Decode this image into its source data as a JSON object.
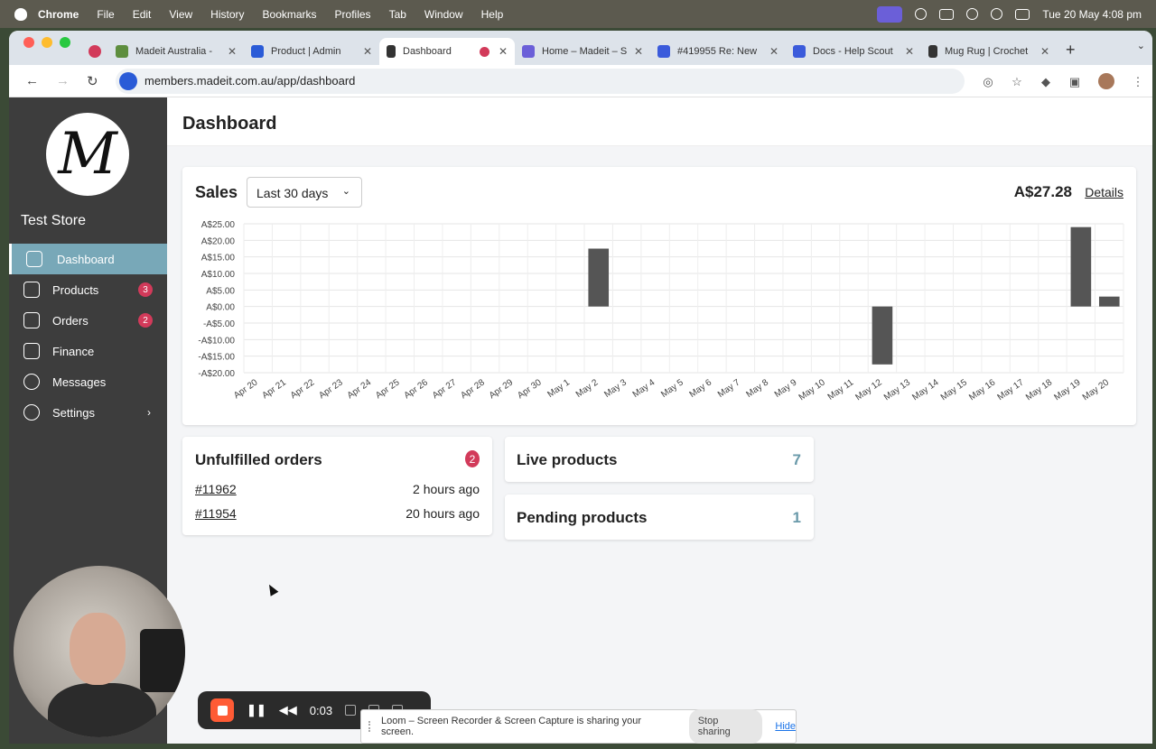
{
  "menubar": {
    "app": "Chrome",
    "items": [
      "File",
      "Edit",
      "View",
      "History",
      "Bookmarks",
      "Profiles",
      "Tab",
      "Window",
      "Help"
    ],
    "clock": "Tue 20 May  4:08 pm"
  },
  "tabs": [
    {
      "title": "Madeit Australia -",
      "icon": "shopify-icon",
      "color": "#5e8e3e"
    },
    {
      "title": "Product | Admin",
      "icon": "admin-icon",
      "color": "#2a5bd7"
    },
    {
      "title": "Dashboard",
      "icon": "madeit-icon",
      "color": "#333333",
      "active": true
    },
    {
      "title": "Home – Madeit – S",
      "icon": "s-icon",
      "color": "#6b5fd8"
    },
    {
      "title": "#419955 Re: New",
      "icon": "helpscout-icon",
      "color": "#3b5bdb"
    },
    {
      "title": "Docs - Help Scout",
      "icon": "helpscout-icon",
      "color": "#3b5bdb"
    },
    {
      "title": "Mug Rug | Crochet",
      "icon": "madeit-icon",
      "color": "#333333"
    }
  ],
  "address": {
    "url": "members.madeit.com.au/app/dashboard"
  },
  "sidebar": {
    "logo": "M",
    "store_name": "Test Store",
    "items": [
      {
        "label": "Dashboard",
        "icon": "home-icon",
        "active": true
      },
      {
        "label": "Products",
        "icon": "layers-icon",
        "badge": "3"
      },
      {
        "label": "Orders",
        "icon": "book-icon",
        "badge": "2"
      },
      {
        "label": "Finance",
        "icon": "money-icon"
      },
      {
        "label": "Messages",
        "icon": "chat-icon"
      },
      {
        "label": "Settings",
        "icon": "gear-icon",
        "chevron": "›"
      }
    ]
  },
  "page": {
    "title": "Dashboard"
  },
  "sales": {
    "heading": "Sales",
    "range": "Last 30 days",
    "total": "A$27.28",
    "details_label": "Details"
  },
  "chart_data": {
    "type": "bar",
    "title": "",
    "xlabel": "",
    "ylabel": "",
    "ylim": [
      -20,
      25
    ],
    "yticks": [
      "A$25.00",
      "A$20.00",
      "A$15.00",
      "A$10.00",
      "A$5.00",
      "A$0.00",
      "-A$5.00",
      "-A$10.00",
      "-A$15.00",
      "-A$20.00"
    ],
    "categories": [
      "Apr 20",
      "Apr 21",
      "Apr 22",
      "Apr 23",
      "Apr 24",
      "Apr 25",
      "Apr 26",
      "Apr 27",
      "Apr 28",
      "Apr 29",
      "Apr 30",
      "May 1",
      "May 2",
      "May 3",
      "May 4",
      "May 5",
      "May 6",
      "May 7",
      "May 8",
      "May 9",
      "May 10",
      "May 11",
      "May 12",
      "May 13",
      "May 14",
      "May 15",
      "May 16",
      "May 17",
      "May 18",
      "May 19",
      "May 20"
    ],
    "values": [
      0,
      0,
      0,
      0,
      0,
      0,
      0,
      0,
      0,
      0,
      0,
      0,
      17.5,
      0,
      0,
      0,
      0,
      0,
      0,
      0,
      0,
      0,
      -17.5,
      0,
      0,
      0,
      0,
      0,
      0,
      24,
      3
    ],
    "grid": true,
    "bar_color": "#555555"
  },
  "unfulfilled": {
    "heading": "Unfulfilled orders",
    "count": "2",
    "orders": [
      {
        "id": "#11962",
        "time": "2 hours ago"
      },
      {
        "id": "#11954",
        "time": "20 hours ago"
      }
    ]
  },
  "live_products": {
    "label": "Live products",
    "value": "7"
  },
  "pending_products": {
    "label": "Pending products",
    "value": "1"
  },
  "loom": {
    "timer": "0:03",
    "share_text": "Loom – Screen Recorder & Screen Capture is sharing your screen.",
    "stop_label": "Stop sharing",
    "hide_label": "Hide"
  }
}
